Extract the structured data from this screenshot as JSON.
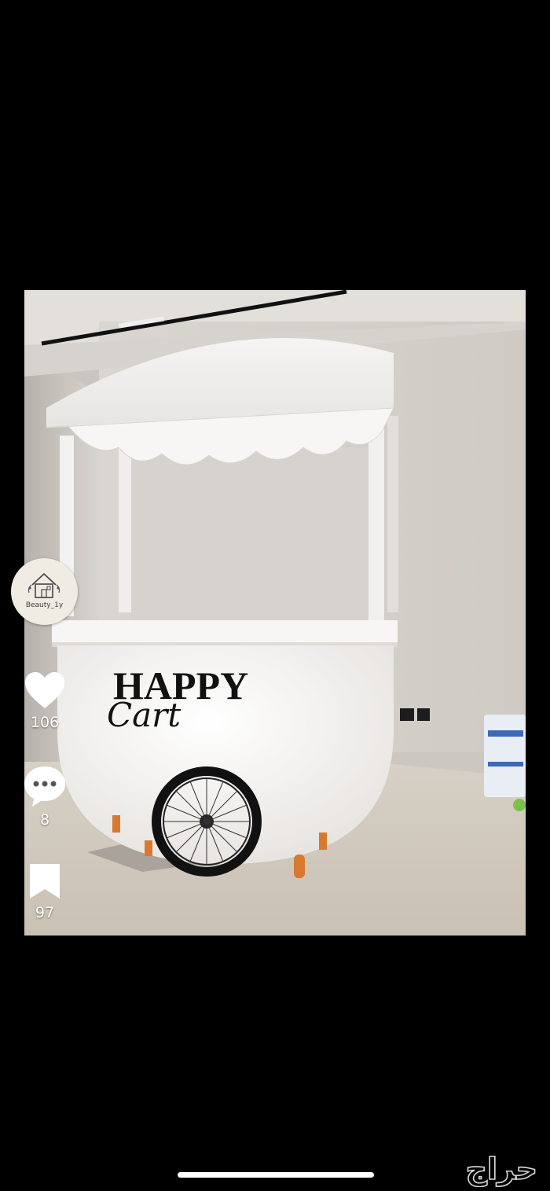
{
  "profile": {
    "name": "Beauty_1y"
  },
  "actions": {
    "likes": "106",
    "comments": "8",
    "saves": "97"
  },
  "photo": {
    "sign_main": "HAPPY",
    "sign_script": "Cart"
  },
  "watermark": "حراج",
  "colors": {
    "background": "#000000",
    "icon": "#ffffff"
  }
}
